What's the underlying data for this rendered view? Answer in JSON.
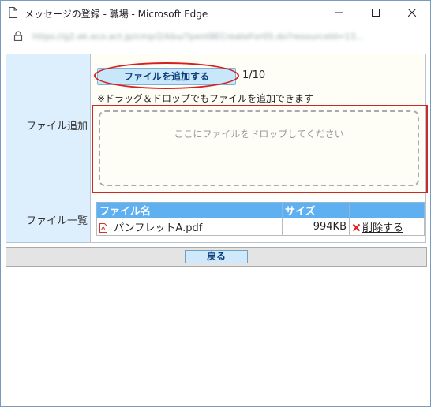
{
  "window": {
    "title": "メッセージの登録 - 職場 - Microsoft Edge",
    "url": "https://g2.ek.eco.act.jp/cmp/2/kbu/?pent8ECreateFor0S.do?resourceId=13..."
  },
  "form": {
    "add_label": "ファイル追加",
    "add_button": "ファイルを追加する",
    "count": "1/10",
    "note": "※ドラッグ＆ドロップでもファイルを追加できます",
    "drop_text": "ここにファイルをドロップしてください",
    "list_label": "ファイル一覧",
    "columns": [
      "ファイル名",
      "サイズ",
      ""
    ],
    "files": [
      {
        "name": "パンフレットA.pdf",
        "size": "994KB",
        "action": "削除する"
      }
    ]
  },
  "footer": {
    "back_button": "戻る"
  },
  "colors": {
    "accent": "#5fb0f0",
    "highlight": "#d81e1e",
    "label_bg": "#ddeefc"
  }
}
